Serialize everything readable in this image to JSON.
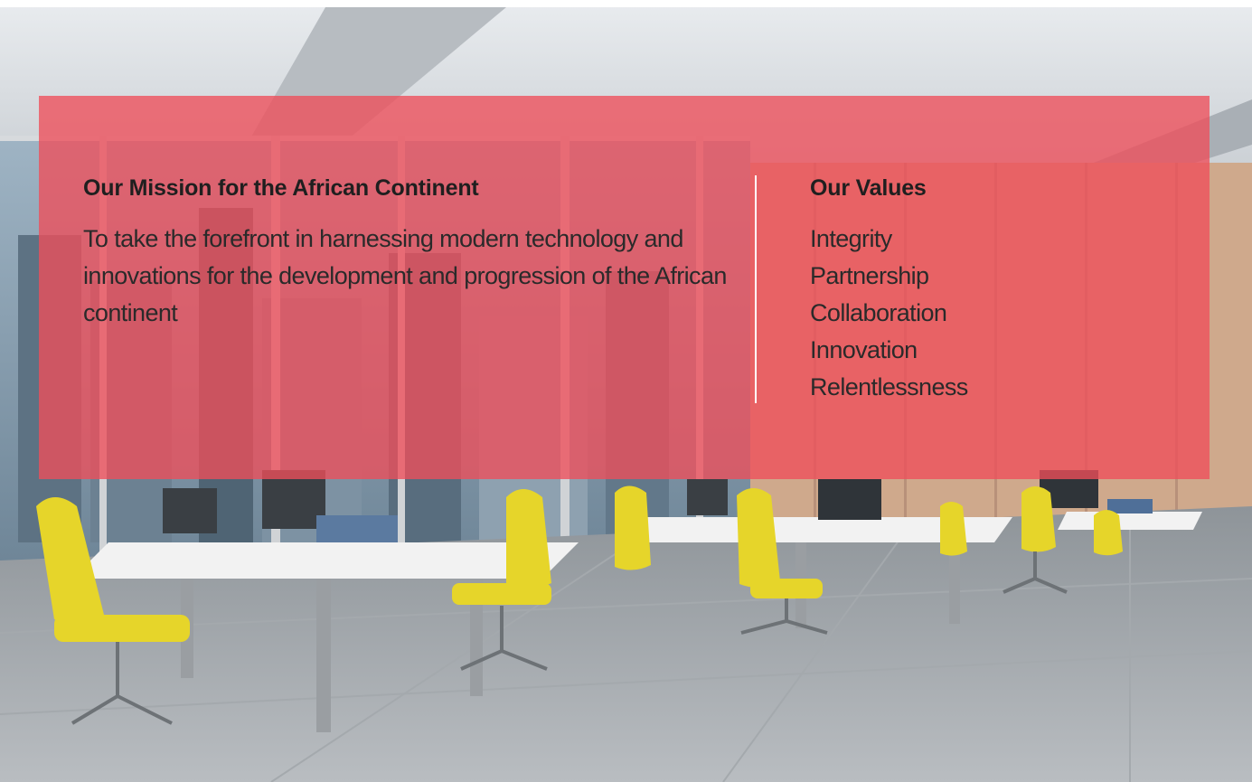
{
  "mission": {
    "heading": "Our Mission for the African Continent",
    "text": "To take the forefront in harnessing modern technology and innovations for the development and progression of the African continent"
  },
  "values": {
    "heading": "Our Values",
    "items": [
      "Integrity",
      "Partnership",
      "Collaboration",
      "Innovation",
      "Relentlessness"
    ]
  },
  "colors": {
    "panel_overlay": "#EE4E5A",
    "divider": "#FFFFFF",
    "chair": "#E6D52A"
  }
}
